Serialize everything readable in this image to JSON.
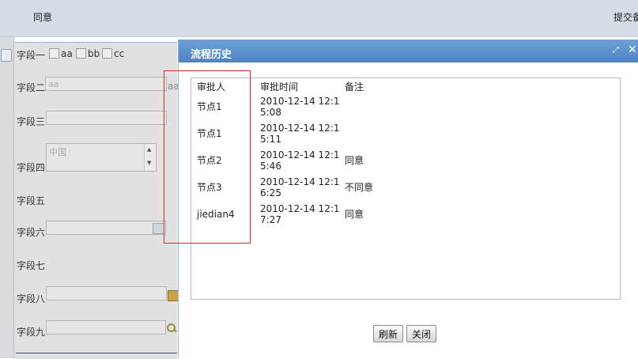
{
  "toolbar": {
    "agree_label": "同意",
    "submit_label": "提交备"
  },
  "form": {
    "field1": {
      "label": "字段一",
      "options": [
        "aa",
        "bb",
        "cc"
      ]
    },
    "field2": {
      "label": "字段二",
      "value": "aa",
      "suffix": "aa"
    },
    "field3": {
      "label": "字段三"
    },
    "field4": {
      "label": "字段四",
      "value": "中国"
    },
    "field5": {
      "label": "字段五"
    },
    "field6": {
      "label": "字段六"
    },
    "field7": {
      "label": "字段七"
    },
    "field8": {
      "label": "字段八"
    },
    "field9": {
      "label": "字段九"
    }
  },
  "dialog": {
    "title": "流程历史",
    "columns": [
      "审批人",
      "审批时间",
      "备注"
    ],
    "rows": [
      {
        "approver": "节点1",
        "time1": "2010-12-14 12:1",
        "time2": "5:08",
        "note": ""
      },
      {
        "approver": "节点1",
        "time1": "2010-12-14 12:1",
        "time2": "5:11",
        "note": ""
      },
      {
        "approver": "节点2",
        "time1": "2010-12-14 12:1",
        "time2": "5:46",
        "note": "同意"
      },
      {
        "approver": "节点3",
        "time1": "2010-12-14 12:1",
        "time2": "6:25",
        "note": "不同意"
      },
      {
        "approver": "jiedian4",
        "time1": "2010-12-14 12:1",
        "time2": "7:27",
        "note": "同意"
      }
    ],
    "refresh_label": "刷新",
    "close_label": "关闭"
  },
  "icons": {
    "maximize": "maximize-icon",
    "close": "close-icon",
    "calendar": "calendar-icon",
    "house": "house-icon",
    "search": "search-icon"
  },
  "colors": {
    "header": "#5a8fcc",
    "highlight_box": "#e0282c"
  }
}
